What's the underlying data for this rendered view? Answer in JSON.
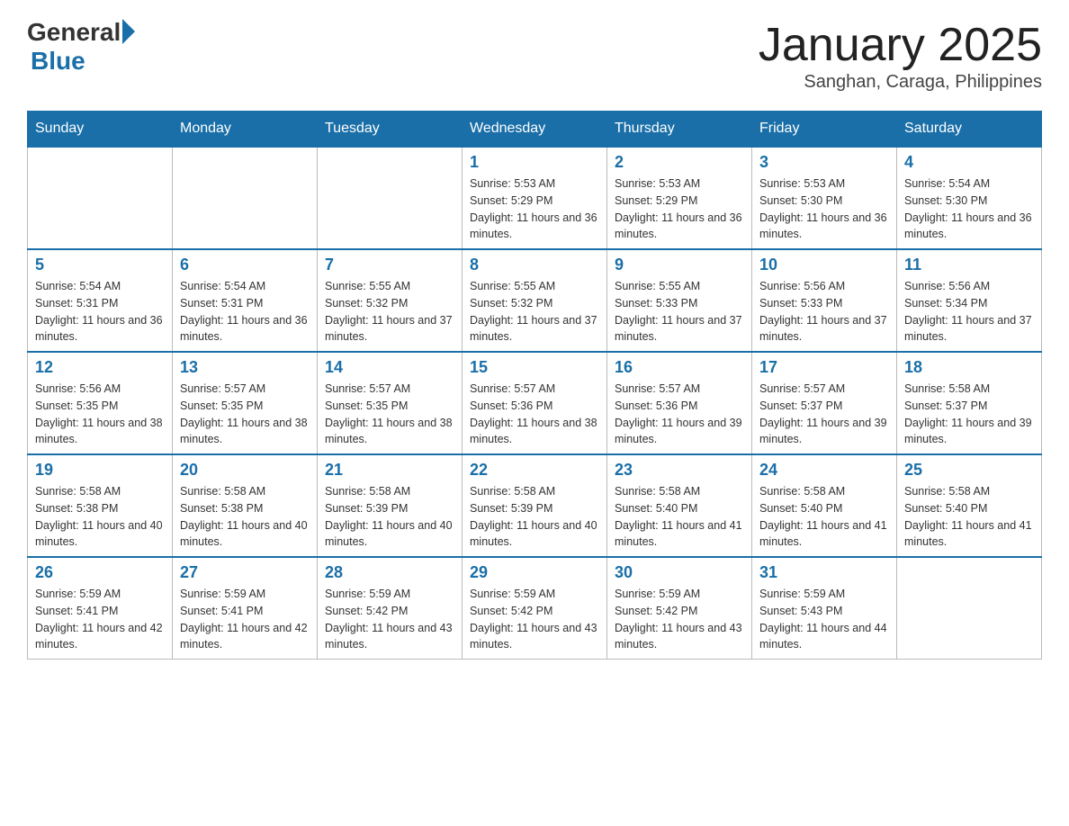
{
  "header": {
    "logo_general": "General",
    "logo_blue": "Blue",
    "title": "January 2025",
    "subtitle": "Sanghan, Caraga, Philippines"
  },
  "calendar": {
    "days_of_week": [
      "Sunday",
      "Monday",
      "Tuesday",
      "Wednesday",
      "Thursday",
      "Friday",
      "Saturday"
    ],
    "weeks": [
      [
        {
          "day": "",
          "info": ""
        },
        {
          "day": "",
          "info": ""
        },
        {
          "day": "",
          "info": ""
        },
        {
          "day": "1",
          "info": "Sunrise: 5:53 AM\nSunset: 5:29 PM\nDaylight: 11 hours and 36 minutes."
        },
        {
          "day": "2",
          "info": "Sunrise: 5:53 AM\nSunset: 5:29 PM\nDaylight: 11 hours and 36 minutes."
        },
        {
          "day": "3",
          "info": "Sunrise: 5:53 AM\nSunset: 5:30 PM\nDaylight: 11 hours and 36 minutes."
        },
        {
          "day": "4",
          "info": "Sunrise: 5:54 AM\nSunset: 5:30 PM\nDaylight: 11 hours and 36 minutes."
        }
      ],
      [
        {
          "day": "5",
          "info": "Sunrise: 5:54 AM\nSunset: 5:31 PM\nDaylight: 11 hours and 36 minutes."
        },
        {
          "day": "6",
          "info": "Sunrise: 5:54 AM\nSunset: 5:31 PM\nDaylight: 11 hours and 36 minutes."
        },
        {
          "day": "7",
          "info": "Sunrise: 5:55 AM\nSunset: 5:32 PM\nDaylight: 11 hours and 37 minutes."
        },
        {
          "day": "8",
          "info": "Sunrise: 5:55 AM\nSunset: 5:32 PM\nDaylight: 11 hours and 37 minutes."
        },
        {
          "day": "9",
          "info": "Sunrise: 5:55 AM\nSunset: 5:33 PM\nDaylight: 11 hours and 37 minutes."
        },
        {
          "day": "10",
          "info": "Sunrise: 5:56 AM\nSunset: 5:33 PM\nDaylight: 11 hours and 37 minutes."
        },
        {
          "day": "11",
          "info": "Sunrise: 5:56 AM\nSunset: 5:34 PM\nDaylight: 11 hours and 37 minutes."
        }
      ],
      [
        {
          "day": "12",
          "info": "Sunrise: 5:56 AM\nSunset: 5:35 PM\nDaylight: 11 hours and 38 minutes."
        },
        {
          "day": "13",
          "info": "Sunrise: 5:57 AM\nSunset: 5:35 PM\nDaylight: 11 hours and 38 minutes."
        },
        {
          "day": "14",
          "info": "Sunrise: 5:57 AM\nSunset: 5:35 PM\nDaylight: 11 hours and 38 minutes."
        },
        {
          "day": "15",
          "info": "Sunrise: 5:57 AM\nSunset: 5:36 PM\nDaylight: 11 hours and 38 minutes."
        },
        {
          "day": "16",
          "info": "Sunrise: 5:57 AM\nSunset: 5:36 PM\nDaylight: 11 hours and 39 minutes."
        },
        {
          "day": "17",
          "info": "Sunrise: 5:57 AM\nSunset: 5:37 PM\nDaylight: 11 hours and 39 minutes."
        },
        {
          "day": "18",
          "info": "Sunrise: 5:58 AM\nSunset: 5:37 PM\nDaylight: 11 hours and 39 minutes."
        }
      ],
      [
        {
          "day": "19",
          "info": "Sunrise: 5:58 AM\nSunset: 5:38 PM\nDaylight: 11 hours and 40 minutes."
        },
        {
          "day": "20",
          "info": "Sunrise: 5:58 AM\nSunset: 5:38 PM\nDaylight: 11 hours and 40 minutes."
        },
        {
          "day": "21",
          "info": "Sunrise: 5:58 AM\nSunset: 5:39 PM\nDaylight: 11 hours and 40 minutes."
        },
        {
          "day": "22",
          "info": "Sunrise: 5:58 AM\nSunset: 5:39 PM\nDaylight: 11 hours and 40 minutes."
        },
        {
          "day": "23",
          "info": "Sunrise: 5:58 AM\nSunset: 5:40 PM\nDaylight: 11 hours and 41 minutes."
        },
        {
          "day": "24",
          "info": "Sunrise: 5:58 AM\nSunset: 5:40 PM\nDaylight: 11 hours and 41 minutes."
        },
        {
          "day": "25",
          "info": "Sunrise: 5:58 AM\nSunset: 5:40 PM\nDaylight: 11 hours and 41 minutes."
        }
      ],
      [
        {
          "day": "26",
          "info": "Sunrise: 5:59 AM\nSunset: 5:41 PM\nDaylight: 11 hours and 42 minutes."
        },
        {
          "day": "27",
          "info": "Sunrise: 5:59 AM\nSunset: 5:41 PM\nDaylight: 11 hours and 42 minutes."
        },
        {
          "day": "28",
          "info": "Sunrise: 5:59 AM\nSunset: 5:42 PM\nDaylight: 11 hours and 43 minutes."
        },
        {
          "day": "29",
          "info": "Sunrise: 5:59 AM\nSunset: 5:42 PM\nDaylight: 11 hours and 43 minutes."
        },
        {
          "day": "30",
          "info": "Sunrise: 5:59 AM\nSunset: 5:42 PM\nDaylight: 11 hours and 43 minutes."
        },
        {
          "day": "31",
          "info": "Sunrise: 5:59 AM\nSunset: 5:43 PM\nDaylight: 11 hours and 44 minutes."
        },
        {
          "day": "",
          "info": ""
        }
      ]
    ]
  }
}
